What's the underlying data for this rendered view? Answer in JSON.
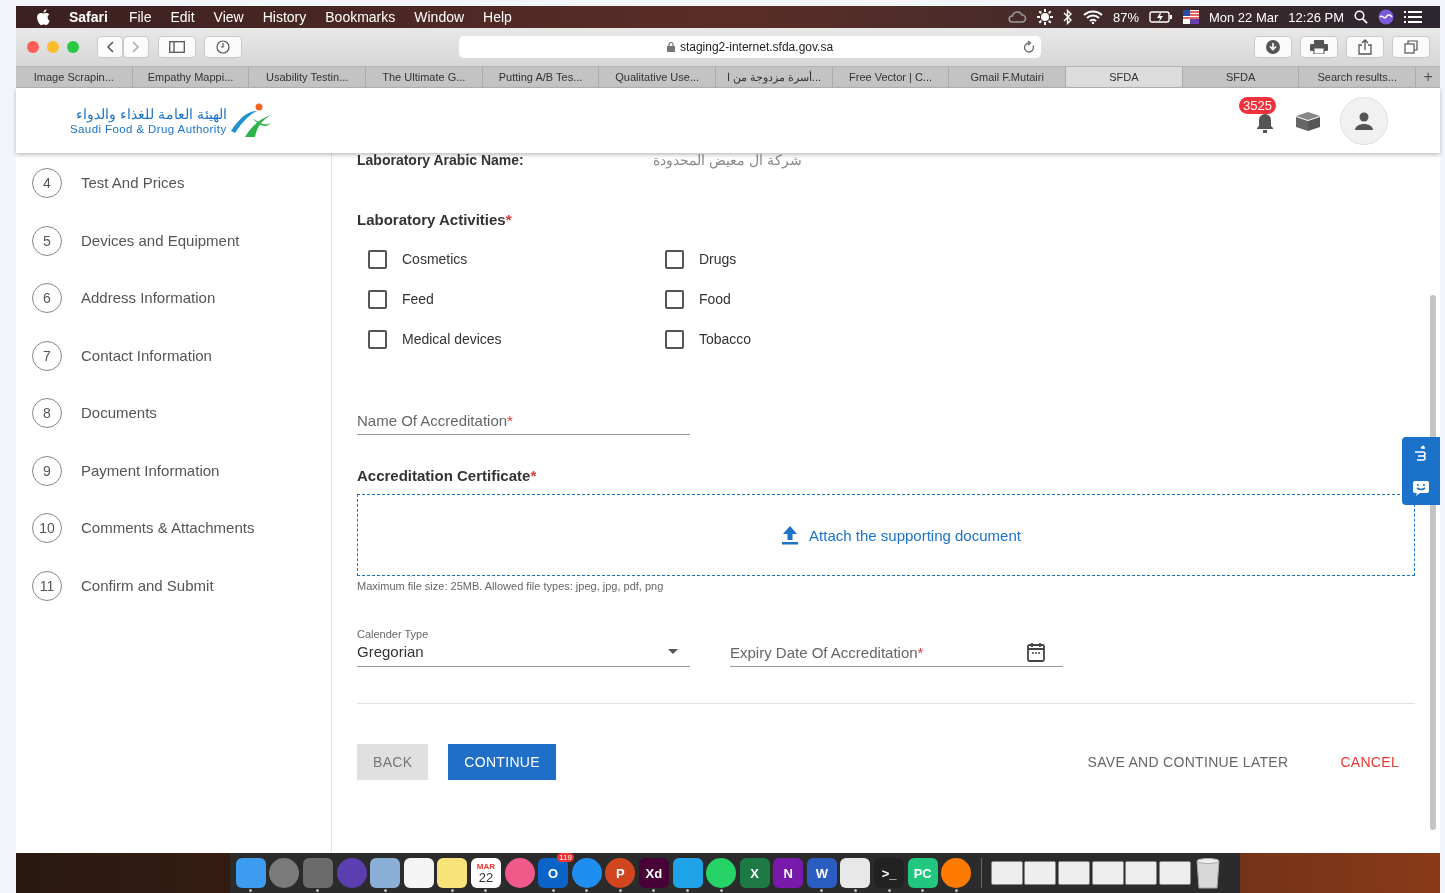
{
  "menu_bar": {
    "app": "Safari",
    "items": [
      "File",
      "Edit",
      "View",
      "History",
      "Bookmarks",
      "Window",
      "Help"
    ],
    "battery": "87%",
    "date": "Mon 22 Mar",
    "time": "12:26 PM"
  },
  "toolbar": {
    "address": "staging2-internet.sfda.gov.sa"
  },
  "tabs": [
    {
      "label": "Image Scrapin...",
      "selected": false
    },
    {
      "label": "Empathy Mappi...",
      "selected": false
    },
    {
      "label": "Usability Testin...",
      "selected": false
    },
    {
      "label": "The Ultimate G...",
      "selected": false
    },
    {
      "label": "Putting A/B Tes...",
      "selected": false
    },
    {
      "label": "Qualitative Use...",
      "selected": false
    },
    {
      "label": "أسرة مزدوجة من ا...",
      "selected": false
    },
    {
      "label": "Free Vector | C...",
      "selected": false
    },
    {
      "label": "Gmail F.Mutairi",
      "selected": false
    },
    {
      "label": "SFDA",
      "selected": true
    },
    {
      "label": "SFDA",
      "selected": false
    },
    {
      "label": "Search results...",
      "selected": false
    }
  ],
  "new_tab": "+",
  "header": {
    "logo_arabic": "الهيئة العامة للغذاء والدواء",
    "logo_english": "Saudi Food & Drug Authority",
    "notifications": "3525"
  },
  "steps": [
    {
      "number": "4",
      "label": "Test And Prices"
    },
    {
      "number": "5",
      "label": "Devices and Equipment"
    },
    {
      "number": "6",
      "label": "Address Information"
    },
    {
      "number": "7",
      "label": "Contact Information"
    },
    {
      "number": "8",
      "label": "Documents"
    },
    {
      "number": "9",
      "label": "Payment Information"
    },
    {
      "number": "10",
      "label": "Comments & Attachments"
    },
    {
      "number": "11",
      "label": "Confirm and Submit"
    }
  ],
  "form": {
    "arabic_name_label": "Laboratory Arabic Name:",
    "arabic_name_value": "شركة ال معيض المحدودة",
    "activities_label": "Laboratory Activities",
    "activities_mark": "*",
    "activities": [
      {
        "label": "Cosmetics",
        "checked": false
      },
      {
        "label": "Drugs",
        "checked": false
      },
      {
        "label": "Feed",
        "checked": false
      },
      {
        "label": "Food",
        "checked": false
      },
      {
        "label": "Medical devices",
        "checked": false
      },
      {
        "label": "Tobacco",
        "checked": false
      }
    ],
    "accreditation_name": {
      "placeholder": "Name Of Accreditation",
      "mark": "*"
    },
    "certificate_label": "Accreditation Certificate",
    "certificate_mark": "*",
    "attach_link": "Attach the supporting document",
    "attach_hint": "Maximum file size: 25MB. Allowed file types: jpeg, jpg, pdf, png",
    "calendar_type": {
      "label": "Calender Type",
      "value": "Gregorian"
    },
    "expiry_date": {
      "placeholder": "Expiry Date Of Accreditation",
      "mark": "*"
    },
    "buttons": {
      "back": "BACK",
      "continue": "CONTINUE",
      "save_later": "SAVE AND CONTINUE LATER",
      "cancel": "CANCEL"
    }
  },
  "dock": [
    {
      "kind": "tile",
      "color": "#3b9cf0",
      "running": true
    },
    {
      "kind": "round",
      "color": "#7a7a7a",
      "running": false
    },
    {
      "kind": "tile",
      "color": "#6b6b6b",
      "running": true
    },
    {
      "kind": "round",
      "color": "#5b3fb0",
      "running": false
    },
    {
      "kind": "tile",
      "color": "#8ab0d8",
      "running": true
    },
    {
      "kind": "tile",
      "color": "#f4f4f4",
      "running": false
    },
    {
      "kind": "tile",
      "color": "#f8e27a",
      "running": true
    },
    {
      "kind": "calendar",
      "month": "MAR",
      "day": "22",
      "running": true
    },
    {
      "kind": "round",
      "color": "#f05a8a",
      "running": false
    },
    {
      "kind": "tile",
      "color": "#0a64c8",
      "label": "O",
      "badge": "119",
      "running": true
    },
    {
      "kind": "round",
      "color": "#1e8ef0",
      "running": true
    },
    {
      "kind": "round",
      "color": "#d2461f",
      "label": "P",
      "running": true
    },
    {
      "kind": "tile",
      "color": "#470137",
      "label": "Xd",
      "running": true
    },
    {
      "kind": "tile",
      "color": "#1fa3e8",
      "running": true
    },
    {
      "kind": "round",
      "color": "#25d366",
      "running": true
    },
    {
      "kind": "tile",
      "color": "#1d7a45",
      "label": "X",
      "running": false
    },
    {
      "kind": "tile",
      "color": "#7719aa",
      "label": "N",
      "running": false
    },
    {
      "kind": "tile",
      "color": "#2b5cbf",
      "label": "W",
      "running": true
    },
    {
      "kind": "tile",
      "color": "#e8e8e8",
      "running": true
    },
    {
      "kind": "tile",
      "color": "#222222",
      "label": ">_",
      "running": true
    },
    {
      "kind": "tile",
      "color": "#21c77e",
      "label": "PC",
      "running": true
    },
    {
      "kind": "round",
      "color": "#ff7b00",
      "running": true
    },
    {
      "kind": "separator"
    },
    {
      "kind": "thumb",
      "running": false
    },
    {
      "kind": "thumb",
      "running": false
    },
    {
      "kind": "thumb",
      "running": false
    },
    {
      "kind": "thumb",
      "running": false
    },
    {
      "kind": "thumb",
      "running": false
    },
    {
      "kind": "thumb",
      "running": false
    },
    {
      "kind": "trash",
      "running": false
    }
  ]
}
